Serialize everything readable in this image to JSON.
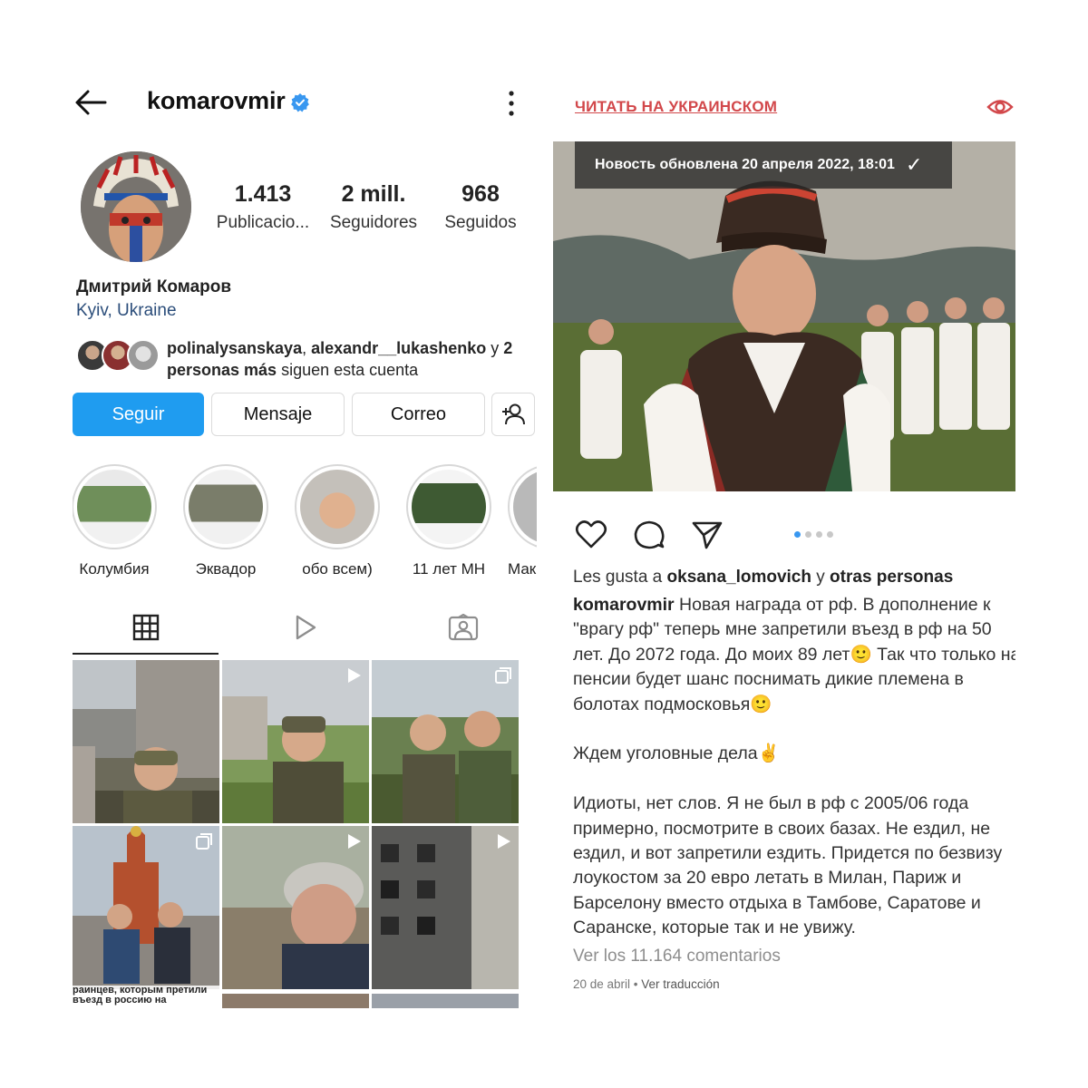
{
  "colors": {
    "follow_blue": "#1f9cf0",
    "verified_blue": "#3897f0",
    "link_red": "#d2474a",
    "location_blue": "#2b4d7a"
  },
  "profile": {
    "username": "komarovmir",
    "icons": {
      "back": "arrow-left-icon",
      "verified": "verified-badge-icon",
      "more": "more-vertical-icon"
    },
    "stats": [
      {
        "num": "1.413",
        "label": "Publicacio..."
      },
      {
        "num": "2 mill.",
        "label": "Seguidores"
      },
      {
        "num": "968",
        "label": "Seguidos"
      }
    ],
    "full_name": "Дмитрий Комаров",
    "location": "Kyiv, Ukraine",
    "followed_by": {
      "user1": "polinalysanskaya",
      "sep": ", ",
      "user2": "alexandr__lukashenko",
      "and": " y ",
      "more": "2 personas más",
      "suffix": " siguen esta cuenta"
    },
    "buttons": {
      "follow": "Seguir",
      "message": "Mensaje",
      "email": "Correo",
      "add_user_icon": "add-person-icon"
    },
    "highlights": [
      {
        "label": "Колумбия"
      },
      {
        "label": "Эквадор"
      },
      {
        "label": "обо всем)"
      },
      {
        "label": "11 лет МН"
      },
      {
        "label": "Мак"
      }
    ],
    "tabs": [
      {
        "icon": "grid-icon",
        "active": true
      },
      {
        "icon": "reels-icon",
        "active": false
      },
      {
        "icon": "tagged-icon",
        "active": false
      }
    ],
    "grid_caption": "раинцев, которым претили въезд в россию на"
  },
  "post": {
    "read_link": "ЧИТАТЬ НА УКРАИНСКОМ",
    "eye_icon": "eye-icon",
    "update_banner": "Новость обновлена 20 апреля 2022, 18:01",
    "actions": {
      "like": "heart-icon",
      "comment": "comment-icon",
      "share": "send-icon"
    },
    "carousel_dots": 4,
    "likes": {
      "prefix": "Les gusta a ",
      "user": "oksana_lomovich",
      "mid": " y ",
      "others": "otras personas"
    },
    "caption_user": "komarovmir",
    "caption_text": " Новая награда от рф. В дополнение к \"врагу рф\" теперь мне запретили въезд в рф на 50 лет. До 2072 года. До моих 89 лет🙂 Так что только на пенсии будет шанс поснимать дикие племена в болотах подмосковья🙂\n\nЖдем уголовные дела✌️\n\nИдиоты, нет слов. Я не был в рф с 2005/06 года примерно, посмотрите в своих базах. Не ездил, не ездил, и вот запретили ездить. Придется по безвизу лоукостом за 20 евро летать в Милан, Париж и Барселону вместо отдыха в Тамбове, Саратове и Саранске, которые так и не увижу.",
    "comments_link": "Ver los 11.164 comentarios",
    "date": "20 de abril",
    "meta_sep": " • ",
    "translate": "Ver traducción"
  }
}
